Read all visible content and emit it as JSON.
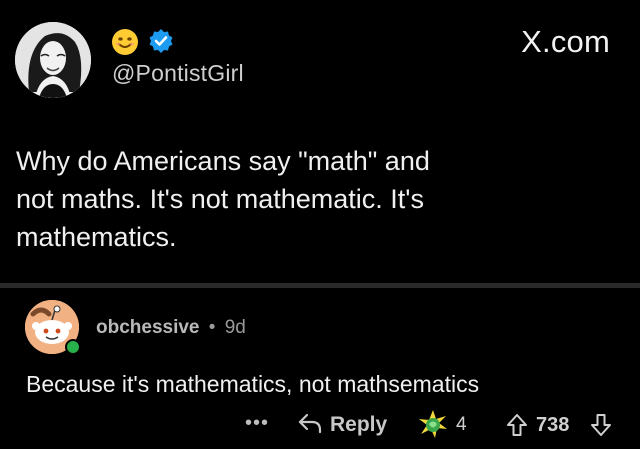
{
  "tweet": {
    "emoji": "smiling-face-emoji",
    "verified_icon": "verified-badge-icon",
    "handle": "@PontistGirl",
    "site": "X.com",
    "lines": [
      "Why do Americans say \"math\" and",
      "not maths. It's not mathematic. It's",
      "mathematics."
    ]
  },
  "comment": {
    "username": "obchessive",
    "separator": "•",
    "age": "9d",
    "text": "Because it's mathematics, not mathsematics",
    "actions": {
      "more": "•••",
      "reply_label": "Reply",
      "award_count": "4",
      "score": "738"
    }
  },
  "colors": {
    "background": "#000000",
    "verified": "#1d9bf0",
    "online": "#28b04a",
    "avatar_bg": "#f2b183"
  }
}
